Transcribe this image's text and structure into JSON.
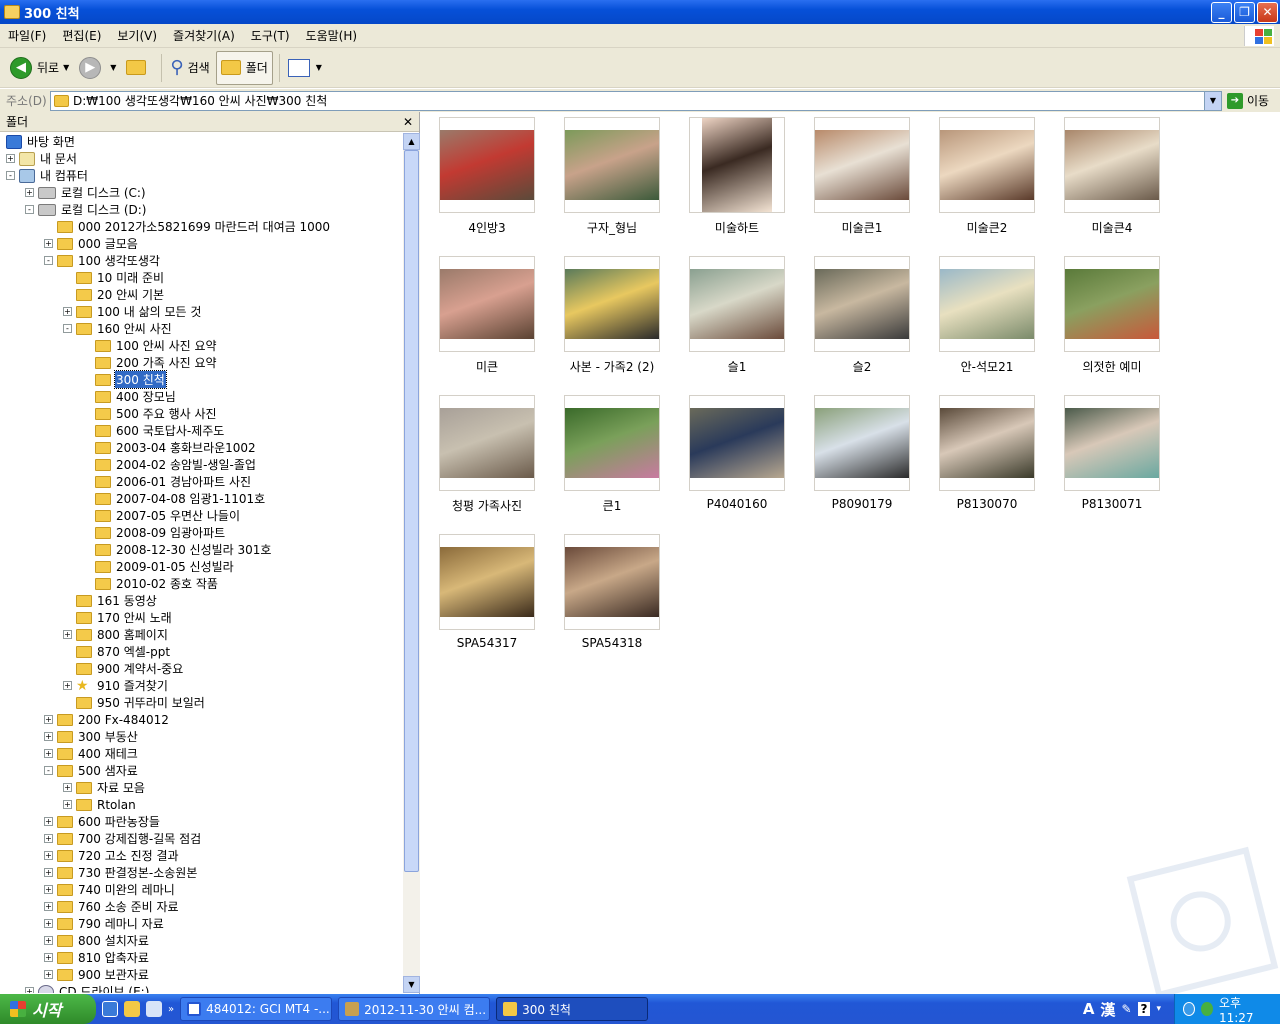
{
  "window": {
    "title": "300 친척"
  },
  "menu": [
    "파일(F)",
    "편집(E)",
    "보기(V)",
    "즐겨찾기(A)",
    "도구(T)",
    "도움말(H)"
  ],
  "toolbar": {
    "back": "뒤로",
    "search": "검색",
    "folders": "폴더"
  },
  "address": {
    "label": "주소(D)",
    "path": "D:₩100 생각또생각₩160 안씨 사진₩300 친척",
    "go": "이동"
  },
  "folder_pane": {
    "title": "폴더",
    "close": "✕"
  },
  "tree": [
    {
      "label": "바탕 화면",
      "level": 0,
      "exp": "",
      "icon": "desktop-icon"
    },
    {
      "label": "내 문서",
      "level": 0,
      "exp": "+",
      "icon": "my-documents-icon"
    },
    {
      "label": "내 컴퓨터",
      "level": 0,
      "exp": "-",
      "icon": "my-computer-icon"
    },
    {
      "label": "로컬 디스크 (C:)",
      "level": 1,
      "exp": "+",
      "icon": "drive-icon"
    },
    {
      "label": "로컬 디스크 (D:)",
      "level": 1,
      "exp": "-",
      "icon": "drive-icon"
    },
    {
      "label": "000 2012가소5821699 마란드러 대여금 1000",
      "level": 2,
      "exp": "",
      "icon": "folder-icon"
    },
    {
      "label": "000 글모음",
      "level": 2,
      "exp": "+",
      "icon": "folder-icon"
    },
    {
      "label": "100 생각또생각",
      "level": 2,
      "exp": "-",
      "icon": "folder-icon"
    },
    {
      "label": "10 미래 준비",
      "level": 3,
      "exp": "",
      "icon": "folder-icon"
    },
    {
      "label": "20 안씨 기본",
      "level": 3,
      "exp": "",
      "icon": "folder-icon"
    },
    {
      "label": "100 내 삶의 모든 것",
      "level": 3,
      "exp": "+",
      "icon": "folder-icon"
    },
    {
      "label": "160 안씨 사진",
      "level": 3,
      "exp": "-",
      "icon": "folder-icon"
    },
    {
      "label": "100 안씨 사진 요약",
      "level": 4,
      "exp": "",
      "icon": "folder-icon"
    },
    {
      "label": "200 가족 사진 요약",
      "level": 4,
      "exp": "",
      "icon": "folder-icon"
    },
    {
      "label": "300 친척",
      "level": 4,
      "exp": "",
      "icon": "folder-icon",
      "selected": true
    },
    {
      "label": "400 장모님",
      "level": 4,
      "exp": "",
      "icon": "folder-icon"
    },
    {
      "label": "500 주요 행사 사진",
      "level": 4,
      "exp": "",
      "icon": "folder-icon"
    },
    {
      "label": "600 국토답사-제주도",
      "level": 4,
      "exp": "",
      "icon": "folder-icon"
    },
    {
      "label": "2003-04 홍화브라운1002",
      "level": 4,
      "exp": "",
      "icon": "folder-icon"
    },
    {
      "label": "2004-02 송암빌-생일-졸업",
      "level": 4,
      "exp": "",
      "icon": "folder-icon"
    },
    {
      "label": "2006-01 경남아파트 사진",
      "level": 4,
      "exp": "",
      "icon": "folder-icon"
    },
    {
      "label": "2007-04-08 임광1-1101호",
      "level": 4,
      "exp": "",
      "icon": "folder-icon"
    },
    {
      "label": "2007-05 우면산 나들이",
      "level": 4,
      "exp": "",
      "icon": "folder-icon"
    },
    {
      "label": "2008-09 임광아파트",
      "level": 4,
      "exp": "",
      "icon": "folder-icon"
    },
    {
      "label": "2008-12-30 신성빌라 301호",
      "level": 4,
      "exp": "",
      "icon": "folder-icon"
    },
    {
      "label": "2009-01-05 신성빌라",
      "level": 4,
      "exp": "",
      "icon": "folder-icon"
    },
    {
      "label": "2010-02 종호 작품",
      "level": 4,
      "exp": "",
      "icon": "folder-icon"
    },
    {
      "label": "161 동영상",
      "level": 3,
      "exp": "",
      "icon": "folder-icon"
    },
    {
      "label": "170 안씨 노래",
      "level": 3,
      "exp": "",
      "icon": "folder-icon"
    },
    {
      "label": "800 홈페이지",
      "level": 3,
      "exp": "+",
      "icon": "folder-icon"
    },
    {
      "label": "870 엑셀-ppt",
      "level": 3,
      "exp": "",
      "icon": "folder-icon"
    },
    {
      "label": "900 계약서-중요",
      "level": 3,
      "exp": "",
      "icon": "folder-icon"
    },
    {
      "label": "910 즐겨찾기",
      "level": 3,
      "exp": "+",
      "icon": "star-icon"
    },
    {
      "label": "950 귀뚜라미 보일러",
      "level": 3,
      "exp": "",
      "icon": "folder-icon"
    },
    {
      "label": "200 Fx-484012",
      "level": 2,
      "exp": "+",
      "icon": "folder-icon"
    },
    {
      "label": "300 부동산",
      "level": 2,
      "exp": "+",
      "icon": "folder-icon"
    },
    {
      "label": "400 재테크",
      "level": 2,
      "exp": "+",
      "icon": "folder-icon"
    },
    {
      "label": "500 샘자료",
      "level": 2,
      "exp": "-",
      "icon": "folder-icon"
    },
    {
      "label": "자료 모음",
      "level": 3,
      "exp": "+",
      "icon": "folder-icon"
    },
    {
      "label": "Rtolan",
      "level": 3,
      "exp": "+",
      "icon": "folder-icon"
    },
    {
      "label": "600 파란농장들",
      "level": 2,
      "exp": "+",
      "icon": "folder-icon"
    },
    {
      "label": "700 강제집행-길목 점검",
      "level": 2,
      "exp": "+",
      "icon": "folder-icon"
    },
    {
      "label": "720 고소 진정 결과",
      "level": 2,
      "exp": "+",
      "icon": "folder-icon"
    },
    {
      "label": "730 판결정본-소송원본",
      "level": 2,
      "exp": "+",
      "icon": "folder-icon"
    },
    {
      "label": "740 미완의 레마니",
      "level": 2,
      "exp": "+",
      "icon": "folder-icon"
    },
    {
      "label": "760 소송 준비 자료",
      "level": 2,
      "exp": "+",
      "icon": "folder-icon"
    },
    {
      "label": "790 레마니 자료",
      "level": 2,
      "exp": "+",
      "icon": "folder-icon"
    },
    {
      "label": "800 설치자료",
      "level": 2,
      "exp": "+",
      "icon": "folder-icon"
    },
    {
      "label": "810 압축자료",
      "level": 2,
      "exp": "+",
      "icon": "folder-icon"
    },
    {
      "label": "900 보관자료",
      "level": 2,
      "exp": "+",
      "icon": "folder-icon"
    },
    {
      "label": "CD 드라이브 (E:)",
      "level": 1,
      "exp": "+",
      "icon": "cd-drive-icon"
    }
  ],
  "thumbnails": [
    {
      "label": "4인방3",
      "colors": [
        "#9a7a6a",
        "#c23a32",
        "#5b4a3a"
      ]
    },
    {
      "label": "구자_형님",
      "colors": [
        "#7c9a5a",
        "#c8a28a",
        "#3c5a3a"
      ]
    },
    {
      "label": "미술하트",
      "colors": [
        "#eed4c4",
        "#3a2a22",
        "#f4e4d4"
      ],
      "tall": true
    },
    {
      "label": "미술큰1",
      "colors": [
        "#b88a6a",
        "#e8e0d4",
        "#6a4a3a"
      ]
    },
    {
      "label": "미술큰2",
      "colors": [
        "#b8967a",
        "#ecd8c0",
        "#5a3a2a"
      ]
    },
    {
      "label": "미술큰4",
      "colors": [
        "#a8866a",
        "#e8dcc8",
        "#6a5a4a"
      ]
    },
    {
      "label": "미큰",
      "colors": [
        "#9a7a6a",
        "#d8a090",
        "#5a4232"
      ]
    },
    {
      "label": "사본 - 가족2 (2)",
      "colors": [
        "#5a7a5a",
        "#e8c860",
        "#2a2a2a"
      ]
    },
    {
      "label": "슬1",
      "colors": [
        "#8aa090",
        "#d8d8c8",
        "#6a4a3a"
      ]
    },
    {
      "label": "슬2",
      "colors": [
        "#6a6a5a",
        "#c8b8a0",
        "#3a3a3a"
      ]
    },
    {
      "label": "안-석모21",
      "colors": [
        "#9ab8c8",
        "#e8e0c0",
        "#7a8a6a"
      ]
    },
    {
      "label": "의젓한 예미",
      "colors": [
        "#5a7a3a",
        "#8aa060",
        "#c8583a"
      ]
    },
    {
      "label": "청평 가족사진",
      "colors": [
        "#a8a098",
        "#c8c0b0",
        "#6a5a4a"
      ]
    },
    {
      "label": "큰1",
      "colors": [
        "#3a6a2a",
        "#7aa05a",
        "#c87aa0"
      ]
    },
    {
      "label": "P4040160",
      "colors": [
        "#6a6a5a",
        "#2a3a5a",
        "#b8a890"
      ]
    },
    {
      "label": "P8090179",
      "colors": [
        "#8aa07a",
        "#d8e0e8",
        "#2a2a2a"
      ]
    },
    {
      "label": "P8130070",
      "colors": [
        "#5a4a3a",
        "#d8c8b8",
        "#3a3a2a"
      ]
    },
    {
      "label": "P8130071",
      "colors": [
        "#4a5a4a",
        "#d8c8b8",
        "#6aa8a0"
      ]
    },
    {
      "label": "SPA54317",
      "colors": [
        "#8a6a3a",
        "#d8b878",
        "#3a2a1a"
      ]
    },
    {
      "label": "SPA54318",
      "colors": [
        "#6a4a3a",
        "#c8a888",
        "#3a2a22"
      ]
    }
  ],
  "taskbar": {
    "start": "시작",
    "tasks": [
      "484012: GCI MT4 -...",
      "2012-11-30 안씨 컴...",
      "300 친척"
    ],
    "ime": [
      "A",
      "漢"
    ],
    "clock": "오후 11:27"
  },
  "colors": {
    "titlebar": "#0650d8",
    "selection": "#316ac5",
    "taskbar": "#2456d2",
    "start": "#3a9a38"
  }
}
